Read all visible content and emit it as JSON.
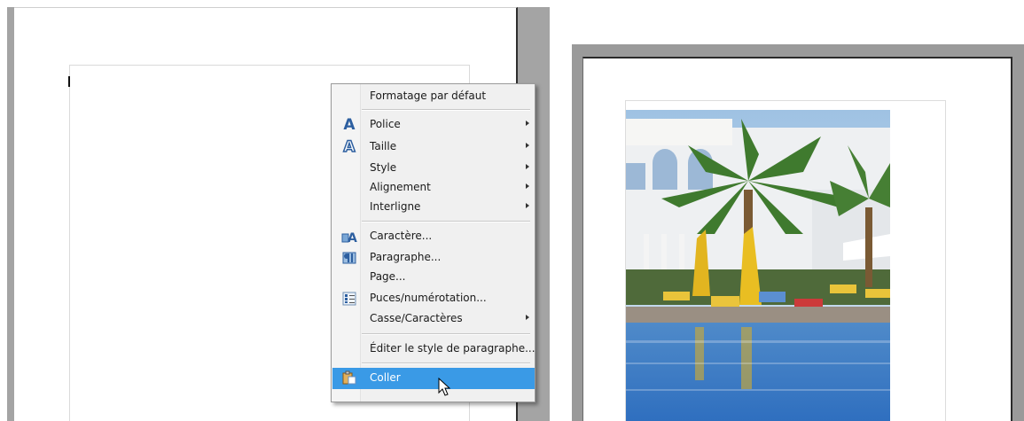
{
  "context_menu": {
    "items": [
      {
        "label": "Formatage par défaut",
        "icon": null,
        "submenu": false
      },
      {
        "label": "Police",
        "icon": "font-icon",
        "submenu": true
      },
      {
        "label": "Taille",
        "icon": "font-size-icon",
        "submenu": true
      },
      {
        "label": "Style",
        "icon": null,
        "submenu": true
      },
      {
        "label": "Alignement",
        "icon": null,
        "submenu": true
      },
      {
        "label": "Interligne",
        "icon": null,
        "submenu": true
      },
      {
        "label": "Caractère...",
        "icon": "character-icon",
        "submenu": false
      },
      {
        "label": "Paragraphe...",
        "icon": "paragraph-icon",
        "submenu": false
      },
      {
        "label": "Page...",
        "icon": null,
        "submenu": false
      },
      {
        "label": "Puces/numérotation...",
        "icon": "bullets-icon",
        "submenu": false
      },
      {
        "label": "Casse/Caractères",
        "icon": null,
        "submenu": true
      },
      {
        "label": "Éditer le style de paragraphe...",
        "icon": null,
        "submenu": false
      },
      {
        "label": "Coller",
        "icon": "paste-icon",
        "submenu": false,
        "highlighted": true
      }
    ]
  },
  "colors": {
    "highlight": "#3a9ae6",
    "icon_blue": "#2d5fa0",
    "frame_gray": "#a4a4a4"
  },
  "right_page": {
    "image": "pool-palm-trees-photo"
  }
}
